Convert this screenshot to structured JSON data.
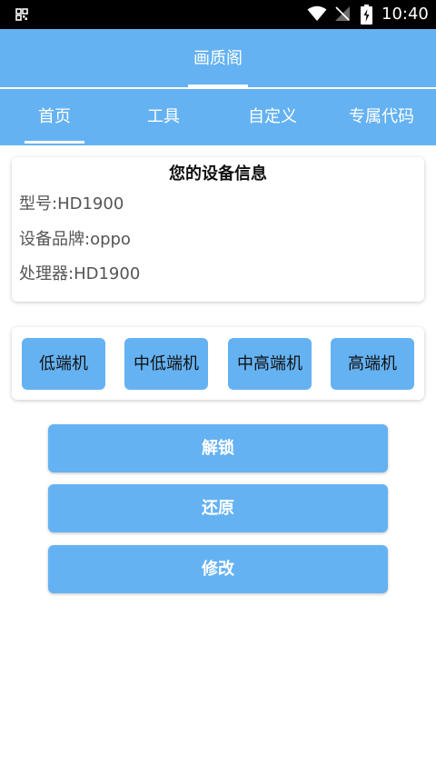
{
  "status_bar": {
    "time": "10:40",
    "icons": [
      "qr-scan-icon",
      "wifi-icon",
      "no-signal-icon",
      "battery-charging-icon"
    ]
  },
  "app": {
    "title": "画质阁"
  },
  "tabs": [
    {
      "label": "首页",
      "selected": true
    },
    {
      "label": "工具",
      "selected": false
    },
    {
      "label": "自定义",
      "selected": false
    },
    {
      "label": "专属代码",
      "selected": false
    }
  ],
  "device_info": {
    "title": "您的设备信息",
    "lines": [
      "型号:HD1900",
      "设备品牌:oppo",
      "处理器:HD1900"
    ]
  },
  "tiers": [
    "低端机",
    "中低端机",
    "中高端机",
    "高端机"
  ],
  "actions": {
    "unlock": "解锁",
    "restore": "还原",
    "modify": "修改"
  },
  "colors": {
    "primary": "#65b2f2",
    "status_bar": "#000000",
    "background": "#ffffff"
  }
}
